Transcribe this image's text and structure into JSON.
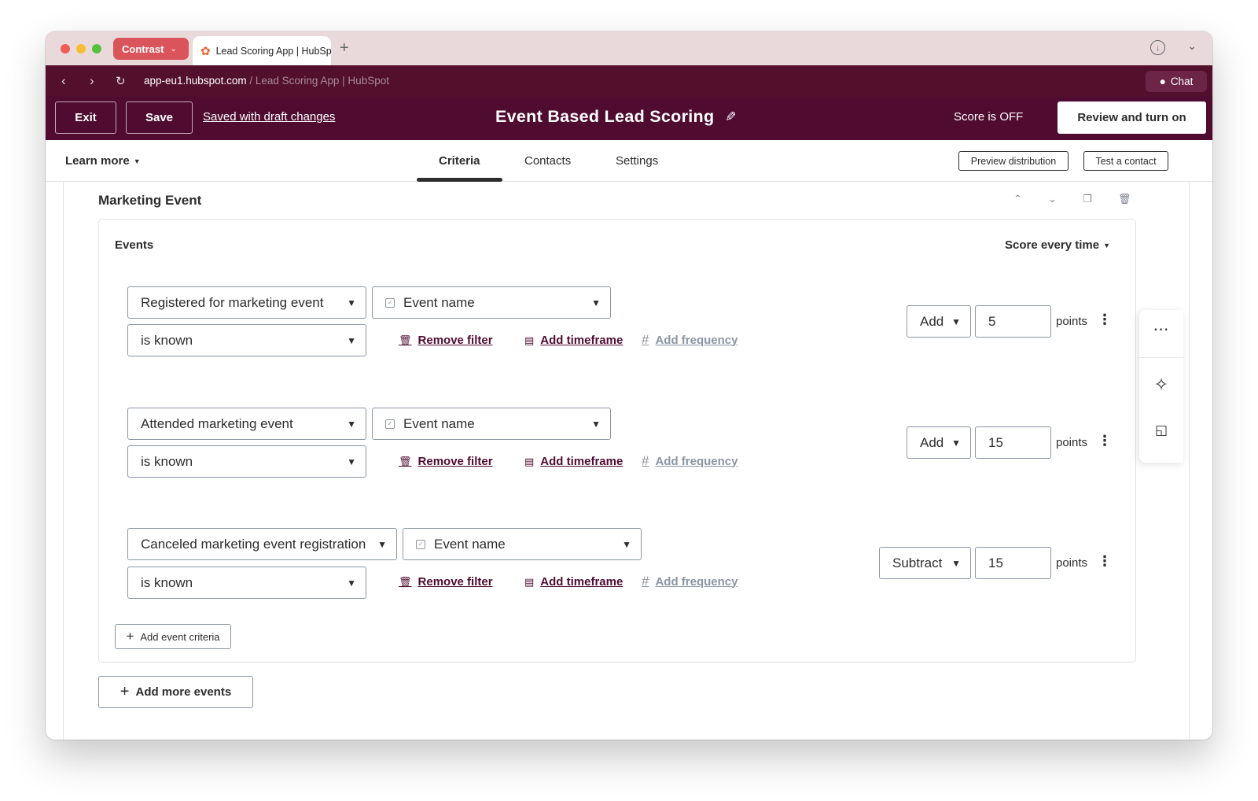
{
  "browser": {
    "profile_label": "Contrast",
    "tab_title": "Lead Scoring App | HubSpot",
    "url_domain": "app-eu1.hubspot.com",
    "url_path": " / Lead Scoring App | HubSpot",
    "chat_label": "Chat"
  },
  "header": {
    "exit_label": "Exit",
    "save_label": "Save",
    "draft_status": "Saved with draft changes",
    "title": "Event Based Lead Scoring",
    "score_status": "Score is OFF",
    "review_label": "Review and turn on"
  },
  "subnav": {
    "learn_more": "Learn more",
    "tabs": [
      "Criteria",
      "Contacts",
      "Settings"
    ],
    "active_tab": "Criteria",
    "preview_label": "Preview distribution",
    "test_label": "Test a contact"
  },
  "section": {
    "title": "Marketing Event",
    "events_label": "Events",
    "score_mode": "Score every time",
    "rules": [
      {
        "event": "Registered for marketing event",
        "property": "Event name",
        "condition": "is known",
        "operation": "Add",
        "points": "5"
      },
      {
        "event": "Attended marketing event",
        "property": "Event name",
        "condition": "is known",
        "operation": "Add",
        "points": "15"
      },
      {
        "event": "Canceled marketing event registration",
        "property": "Event name",
        "condition": "is known",
        "operation": "Subtract",
        "points": "15"
      }
    ],
    "remove_filter": "Remove filter",
    "add_timeframe": "Add timeframe",
    "add_frequency": "Add frequency",
    "points_label": "points",
    "add_event_criteria": "Add event criteria",
    "add_more_events": "Add more events"
  },
  "colors": {
    "brand_dark": "#4f0b30",
    "url_bar": "#53102d",
    "tab_bar": "#ead9da",
    "profile_pill": "#d9555b"
  }
}
